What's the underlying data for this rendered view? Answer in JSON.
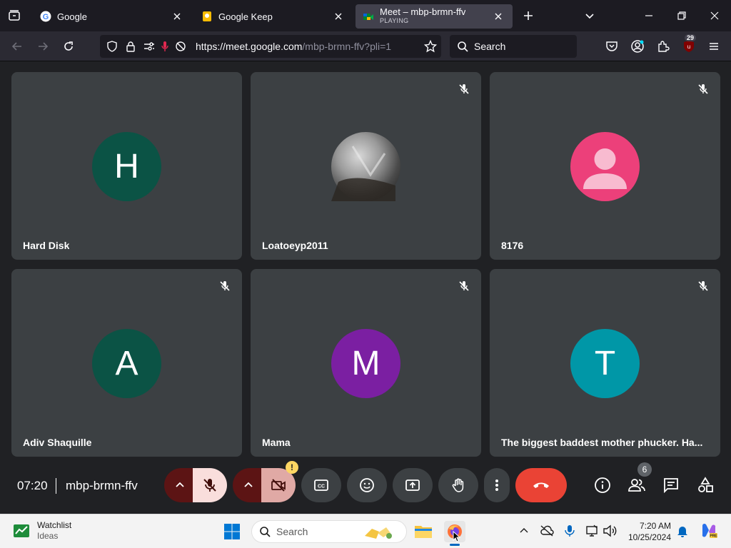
{
  "browser": {
    "tabs": [
      {
        "title": "Google",
        "icon": "google-icon"
      },
      {
        "title": "Google Keep",
        "icon": "keep-icon"
      },
      {
        "title": "Meet – mbp-brmn-ffv",
        "subtitle": "PLAYING",
        "icon": "meet-icon",
        "active": true
      }
    ],
    "url": {
      "host": "https://meet.google.com",
      "path": "/mbp-brmn-ffv?pli=1"
    },
    "search_placeholder": "Search",
    "extension_badge": "29"
  },
  "meet": {
    "tiles": [
      {
        "name": "Hard Disk",
        "initial": "H",
        "color": "#0b5345",
        "muted": false
      },
      {
        "name": "Loatoeyp2011",
        "initial": "",
        "color": "#5f6368",
        "muted": true,
        "photo": true
      },
      {
        "name": "8176",
        "initial": "",
        "color": "#ec407a",
        "muted": true,
        "default_avatar": true
      },
      {
        "name": "Adiv Shaquille",
        "initial": "A",
        "color": "#0b5345",
        "muted": true
      },
      {
        "name": "Mama",
        "initial": "M",
        "color": "#7b1fa2",
        "muted": true
      },
      {
        "name": "The biggest baddest mother phucker. Ha...",
        "initial": "T",
        "color": "#0097a7",
        "muted": true
      }
    ],
    "time": "07:20",
    "meeting_code": "mbp-brmn-ffv",
    "camera_warning": "!",
    "participant_count": "6"
  },
  "taskbar": {
    "widget_title": "Watchlist",
    "widget_subtitle": "Ideas",
    "search_placeholder": "Search",
    "time": "7:20 AM",
    "date": "10/25/2024"
  }
}
